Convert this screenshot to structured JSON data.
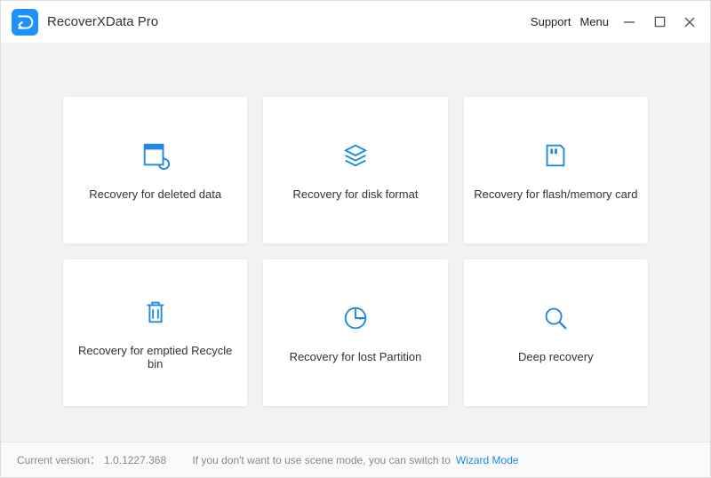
{
  "app": {
    "title": "RecoverXData Pro"
  },
  "titlebar": {
    "support": "Support",
    "menu": "Menu"
  },
  "cards": [
    {
      "label": "Recovery for deleted data"
    },
    {
      "label": "Recovery for disk format"
    },
    {
      "label": "Recovery for flash/memory card"
    },
    {
      "label": "Recovery for emptied Recycle bin"
    },
    {
      "label": "Recovery for lost Partition"
    },
    {
      "label": "Deep recovery"
    }
  ],
  "footer": {
    "version_label": "Current version：",
    "version_value": "1.0.1227.368",
    "hint": "If you don't want to use scene mode, you can switch to",
    "link": "Wizard Mode"
  },
  "colors": {
    "accent": "#1E88E5",
    "logo_bg": "#1E90FF",
    "content_bg": "#f3f3f3"
  }
}
